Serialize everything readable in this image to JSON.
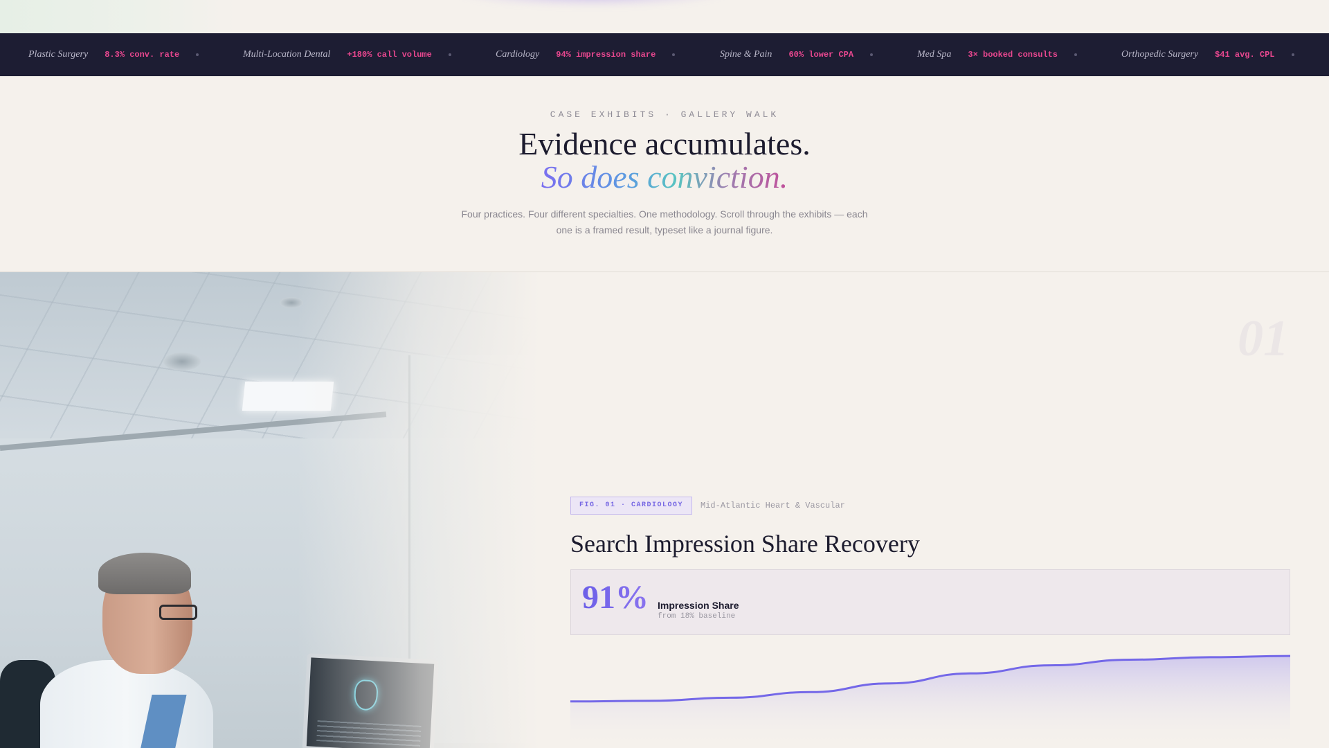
{
  "ticker": {
    "items": [
      {
        "specialty": "Plastic Surgery",
        "metric": "8.3% conv. rate"
      },
      {
        "specialty": "Multi-Location Dental",
        "metric": "+180% call volume"
      },
      {
        "specialty": "Cardiology",
        "metric": "94% impression share"
      },
      {
        "specialty": "Spine & Pain",
        "metric": "60% lower CPA"
      },
      {
        "specialty": "Med Spa",
        "metric": "3× booked consults"
      },
      {
        "specialty": "Orthopedic Surgery",
        "metric": "$41 avg. CPL"
      }
    ]
  },
  "intro": {
    "eyebrow": "CASE EXHIBITS · GALLERY WALK",
    "headline_line1": "Evidence accumulates.",
    "headline_line2": "So does conviction.",
    "lede": "Four practices. Four different specialties. One methodology. Scroll through the exhibits — each one is a framed result, typeset like a journal figure."
  },
  "exhibit": {
    "number": "01",
    "fig_tag": "FIG. 01 · CARDIOLOGY",
    "client": "Mid-Atlantic Heart & Vascular",
    "title": "Search Impression Share Recovery",
    "metric_value": "91%",
    "metric_label": "Impression Share",
    "metric_sub": "from 18% baseline",
    "photo_alt": "doctor-at-cardiology-workstation"
  },
  "colors": {
    "ticker_bg": "#1d1d33",
    "ticker_metric": "#e8478f",
    "accent": "#7566e3",
    "page_bg": "#f5f1ec",
    "ink": "#1c1b2e"
  },
  "chart_data": {
    "type": "area",
    "series": [
      {
        "values": [
          18,
          19,
          24,
          33,
          47,
          63,
          76,
          85,
          89,
          91
        ]
      }
    ],
    "ylim": [
      0,
      100
    ],
    "grid": false
  }
}
